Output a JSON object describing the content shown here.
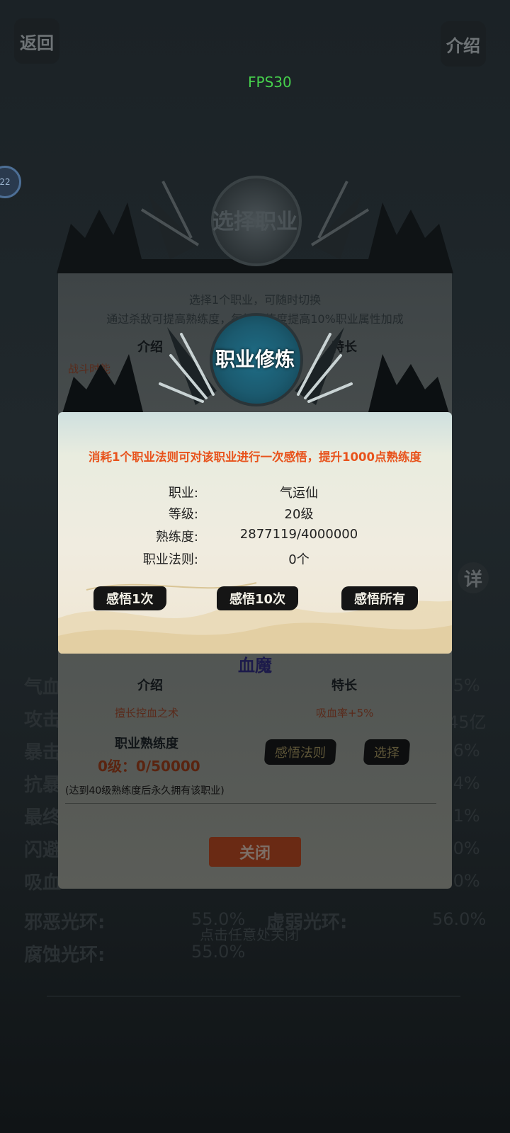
{
  "top": {
    "back_label": "返回",
    "intro_label": "介绍",
    "fps": "FPS30",
    "badge": "22"
  },
  "detail_btn": "详",
  "stats": {
    "rows_left": [
      {
        "label": "气血"
      },
      {
        "label": "攻击"
      },
      {
        "label": "暴击"
      },
      {
        "label": "抗暴"
      },
      {
        "label": "最终"
      },
      {
        "label": "闪避"
      },
      {
        "label": "吸血"
      },
      {
        "label": "邪恶光环:",
        "value": "55.0%"
      },
      {
        "label": "腐蚀光环:",
        "value": "55.0%"
      }
    ],
    "right_label": "虚弱光环:",
    "right_value": "56.0%",
    "right_values": [
      ".5%",
      "45亿",
      ".6%",
      ".4%",
      ".1%",
      ".0%",
      ".0%"
    ]
  },
  "tap_hint": "点击任意处关闭",
  "select_panel": {
    "title": "选择职业",
    "line1": "选择1个职业，可随时切换",
    "line2": "通过杀敌可提高熟练度，每级熟练度提高10%职业属性加成",
    "intro_head": "介绍",
    "specialty_head": "特长",
    "red_partial": "战斗时能",
    "career_partial": "职业",
    "select_partial": "选择",
    "job_name": "血魔",
    "intro_head2": "介绍",
    "specialty_head2": "特长",
    "intro_text": "擅长控血之术",
    "specialty_text": "吸血率+5%",
    "mastery_head": "职业熟练度",
    "mastery_val": "0级：0/50000",
    "enlighten_btn": "感悟法则",
    "select_btn": "选择",
    "note": "(达到40级熟练度后永久拥有该职业)",
    "close_btn": "关闭"
  },
  "dialog": {
    "title": "职业修炼",
    "notice": "消耗1个职业法则可对该职业进行一次感悟，提升1000点熟练度",
    "rows": [
      {
        "label": "职业:",
        "value": "气运仙"
      },
      {
        "label": "等级:",
        "value": "20级"
      },
      {
        "label": "熟练度:",
        "value": "2877119/4000000"
      },
      {
        "label": "职业法则:",
        "value": "0个"
      }
    ],
    "buttons": [
      "感悟1次",
      "感悟10次",
      "感悟所有"
    ]
  }
}
